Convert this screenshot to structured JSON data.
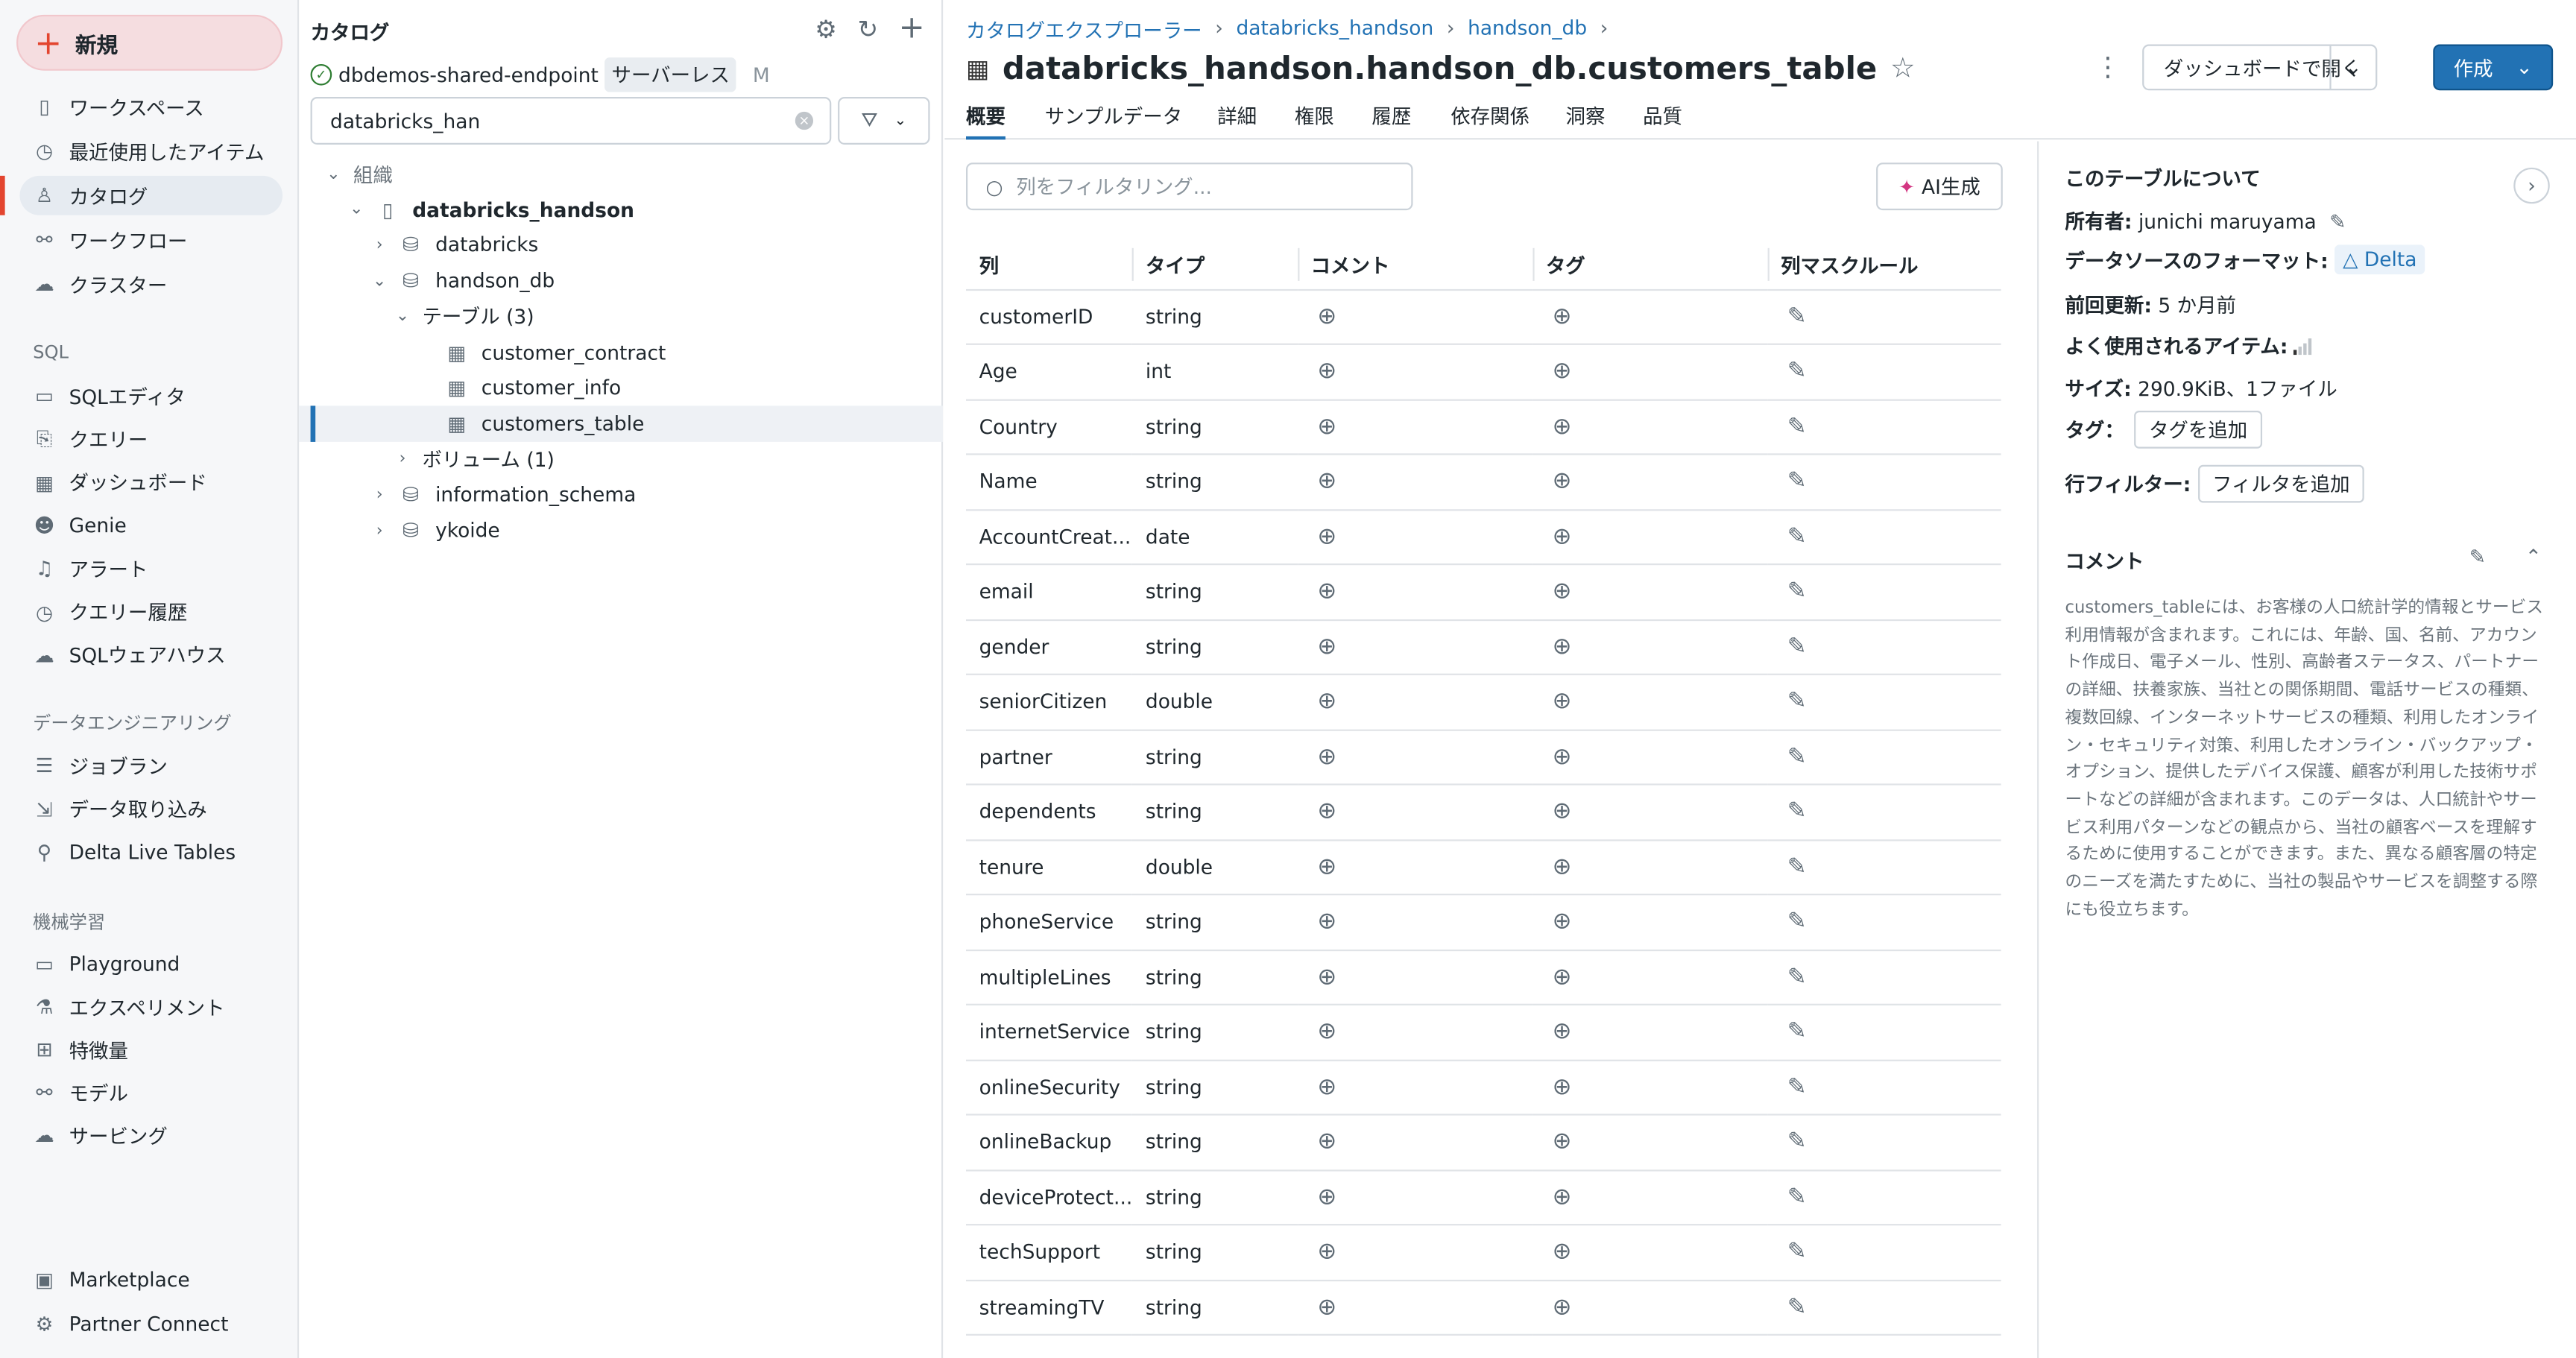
{
  "sidebar": {
    "new_label": "新規",
    "items": [
      {
        "label": "ワークスペース",
        "icon": "notebook-icon"
      },
      {
        "label": "最近使用したアイテム",
        "icon": "clock-icon"
      },
      {
        "label": "カタログ",
        "icon": "catalog-icon",
        "active": true
      },
      {
        "label": "ワークフロー",
        "icon": "workflow-icon"
      },
      {
        "label": "クラスター",
        "icon": "cloud-icon"
      }
    ],
    "sql_header": "SQL",
    "sql_items": [
      {
        "label": "SQLエディタ"
      },
      {
        "label": "クエリー"
      },
      {
        "label": "ダッシュボード"
      },
      {
        "label": "Genie"
      },
      {
        "label": "アラート"
      },
      {
        "label": "クエリー履歴"
      },
      {
        "label": "SQLウェアハウス"
      }
    ],
    "de_header": "データエンジニアリング",
    "de_items": [
      {
        "label": "ジョブラン"
      },
      {
        "label": "データ取り込み"
      },
      {
        "label": "Delta Live Tables"
      }
    ],
    "ml_header": "機械学習",
    "ml_items": [
      {
        "label": "Playground"
      },
      {
        "label": "エクスペリメント"
      },
      {
        "label": "特徴量"
      },
      {
        "label": "モデル"
      },
      {
        "label": "サービング"
      }
    ],
    "bottom_items": [
      {
        "label": "Marketplace"
      },
      {
        "label": "Partner Connect"
      }
    ]
  },
  "catalog": {
    "title": "カタログ",
    "endpoint": "dbdemos-shared-endpoint",
    "endpoint_badge": "サーバーレス",
    "endpoint_size": "M",
    "search_value": "databricks_han",
    "tree": [
      {
        "label": "組織",
        "depth": 0,
        "chev": "v",
        "icon": ""
      },
      {
        "label": "databricks_handson",
        "depth": 1,
        "chev": "v",
        "icon": "▯",
        "bold": true
      },
      {
        "label": "databricks",
        "depth": 2,
        "chev": ">",
        "icon": "⛁"
      },
      {
        "label": "handson_db",
        "depth": 2,
        "chev": "v",
        "icon": "⛁"
      },
      {
        "label": "テーブル (3)",
        "depth": 3,
        "chev": "v",
        "icon": ""
      },
      {
        "label": "customer_contract",
        "depth": 4,
        "chev": "",
        "icon": "▦"
      },
      {
        "label": "customer_info",
        "depth": 4,
        "chev": "",
        "icon": "▦"
      },
      {
        "label": "customers_table",
        "depth": 4,
        "chev": "",
        "icon": "▦",
        "selected": true
      },
      {
        "label": "ボリューム (1)",
        "depth": 3,
        "chev": ">",
        "icon": ""
      },
      {
        "label": "information_schema",
        "depth": 2,
        "chev": ">",
        "icon": "⛁"
      },
      {
        "label": "ykoide",
        "depth": 2,
        "chev": ">",
        "icon": "⛁"
      }
    ]
  },
  "main": {
    "breadcrumb": [
      "カタログエクスプローラー",
      "databricks_handson",
      "handson_db"
    ],
    "title": "databricks_handson.handson_db.customers_table",
    "open_dashboard": "ダッシュボードで開く",
    "create": "作成",
    "tabs": [
      "概要",
      "サンプルデータ",
      "詳細",
      "権限",
      "履歴",
      "依存関係",
      "洞察",
      "品質"
    ],
    "filter_placeholder": "列をフィルタリング...",
    "ai_button": "AI生成",
    "headers": [
      "列",
      "タイプ",
      "コメント",
      "タグ",
      "列マスクルール"
    ],
    "rows": [
      [
        "customerID",
        "string"
      ],
      [
        "Age",
        "int"
      ],
      [
        "Country",
        "string"
      ],
      [
        "Name",
        "string"
      ],
      [
        "AccountCreat...",
        "date"
      ],
      [
        "email",
        "string"
      ],
      [
        "gender",
        "string"
      ],
      [
        "seniorCitizen",
        "double"
      ],
      [
        "partner",
        "string"
      ],
      [
        "dependents",
        "string"
      ],
      [
        "tenure",
        "double"
      ],
      [
        "phoneService",
        "string"
      ],
      [
        "multipleLines",
        "string"
      ],
      [
        "internetService",
        "string"
      ],
      [
        "onlineSecurity",
        "string"
      ],
      [
        "onlineBackup",
        "string"
      ],
      [
        "deviceProtect...",
        "string"
      ],
      [
        "techSupport",
        "string"
      ],
      [
        "streamingTV",
        "string"
      ]
    ]
  },
  "about": {
    "title": "このテーブルについて",
    "owner_label": "所有者:",
    "owner": "junichi maruyama",
    "format_label": "データソースのフォーマット:",
    "format": "Delta",
    "updated_label": "前回更新:",
    "updated": "5 か月前",
    "popularity_label": "よく使用されるアイテム:",
    "popularity_level": 1,
    "size_label": "サイズ:",
    "size": "290.9KiB、1ファイル",
    "tags_label": "タグ：",
    "add_tag": "タグを追加",
    "row_filter_label": "行フィルター:",
    "add_filter": "フィルタを追加",
    "comment_title": "コメント",
    "comment": "customers_tableには、お客様の人口統計学的情報とサービス利用情報が含まれます。これには、年齢、国、名前、アカウント作成日、電子メール、性別、高齢者ステータス、パートナーの詳細、扶養家族、当社との関係期間、電話サービスの種類、複数回線、インターネットサービスの種類、利用したオンライン・セキュリティ対策、利用したオンライン・バックアップ・オプション、提供したデバイス保護、顧客が利用した技術サポートなどの詳細が含まれます。このデータは、人口統計やサービス利用パターンなどの観点から、当社の顧客ベースを理解するために使用することができます。また、異なる顧客層の特定のニーズを満たすために、当社の製品やサービスを調整する際にも役立ちます。"
  },
  "colors": {
    "accent": "#2272b4",
    "new_button": "#f5dde0",
    "brand_red": "#e3452f"
  }
}
